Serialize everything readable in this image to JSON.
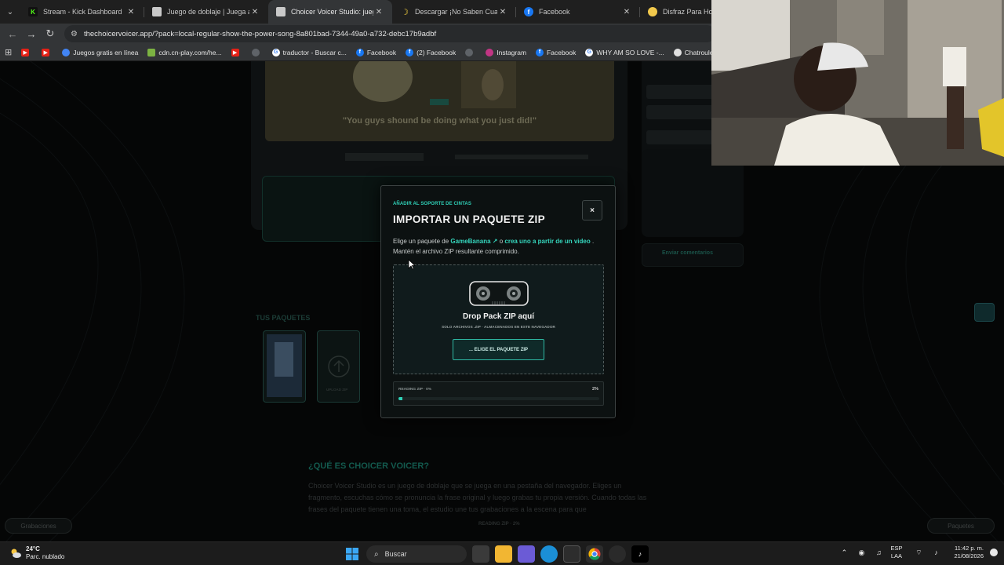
{
  "browser": {
    "tabs": [
      {
        "title": "Stream - Kick Dashboard",
        "favicon": "kick-icon",
        "active": false
      },
      {
        "title": "Juego de doblaje | Juega a Cho",
        "favicon": "page-icon",
        "active": false
      },
      {
        "title": "Choicer Voicer Studio: juego de",
        "favicon": "page-icon",
        "active": true
      },
      {
        "title": "Descargar ¡No Saben Cuanto",
        "favicon": "banana-icon",
        "active": false
      },
      {
        "title": "Facebook",
        "favicon": "facebook-icon",
        "active": false
      },
      {
        "title": "Disfraz Para Homb",
        "favicon": "shop-icon",
        "active": false
      }
    ],
    "url": "thechoicervoicer.app/?pack=local-regular-show-the-power-song-8a801bad-7344-49a0-a732-debc17b9adbf",
    "bookmarks": [
      {
        "label": "",
        "icon": "youtube-icon"
      },
      {
        "label": "",
        "icon": "youtube-icon"
      },
      {
        "label": "Juegos gratis en línea",
        "icon": "game-icon"
      },
      {
        "label": "cdn.cn-play.com/he...",
        "icon": "cdn-icon"
      },
      {
        "label": "",
        "icon": "youtube-icon"
      },
      {
        "label": "",
        "icon": "globe-icon"
      },
      {
        "label": "traductor - Buscar c...",
        "icon": "google-icon"
      },
      {
        "label": "Facebook",
        "icon": "facebook-icon"
      },
      {
        "label": "(2) Facebook",
        "icon": "facebook-icon"
      },
      {
        "label": "",
        "icon": "globe-icon"
      },
      {
        "label": "Instagram",
        "icon": "instagram-icon"
      },
      {
        "label": "Facebook",
        "icon": "facebook-icon"
      },
      {
        "label": "WHY AM SO LOVE -...",
        "icon": "google-icon"
      },
      {
        "label": "Chatroulette españ...",
        "icon": "chat-icon"
      }
    ]
  },
  "page": {
    "video_subtitle": "\"You guys shound be doing what you just did!\"",
    "section_label_packs": "TUS PAQUETES",
    "upload_card_label": "UPLOAD ZIP",
    "que_title": "¿QUÉ ES CHOICER VOICER?",
    "que_text": "Choicer Voicer Studio es un juego de doblaje que se juega en una pestaña del navegador. Eliges un fragmento, escuchas cómo se pronuncia la frase original y luego grabas tu propia versión. Cuando todas las frases del paquete tienen una toma, el estudio une tus grabaciones a la escena para que",
    "btn_grabaciones": "Grabaciones",
    "btn_paquetes": "Paquetes",
    "reading_footer": "READING ZIP · 2%",
    "send_comments": "Enviar comentarios"
  },
  "modal": {
    "eyebrow": "AÑADIR AL SOPORTE DE CINTAS",
    "title": "IMPORTAR UN PAQUETE ZIP",
    "close_label": "×",
    "desc_prefix": "Elige un paquete de ",
    "link_gamebanana": "GameBanana ↗",
    "desc_mid": " o ",
    "link_create": "crea uno a partir de un video",
    "desc_suffix": " . Mantén el archivo ZIP resultante comprimido.",
    "drop_title": "Drop Pack ZIP aquí",
    "drop_sub": "SOLO ARCHIVOS .ZIP · ALMACENADOS EN ESTE NAVEGADOR",
    "choose_button": "... ELIGE EL PAQUETE ZIP",
    "progress_label": "READING ZIP · 0%",
    "progress_pct": "2%",
    "progress_value": 0.02
  },
  "taskbar": {
    "temp": "24°C",
    "weather": "Parc. nublado",
    "search": "Buscar",
    "lang_top": "ESP",
    "lang_bottom": "LAA",
    "time": "11:42 p. m.",
    "date": "21/08/2026"
  },
  "colors": {
    "accent": "#2fd0b7",
    "modal_bg": "#0c1111",
    "page_bg": "#050606"
  }
}
